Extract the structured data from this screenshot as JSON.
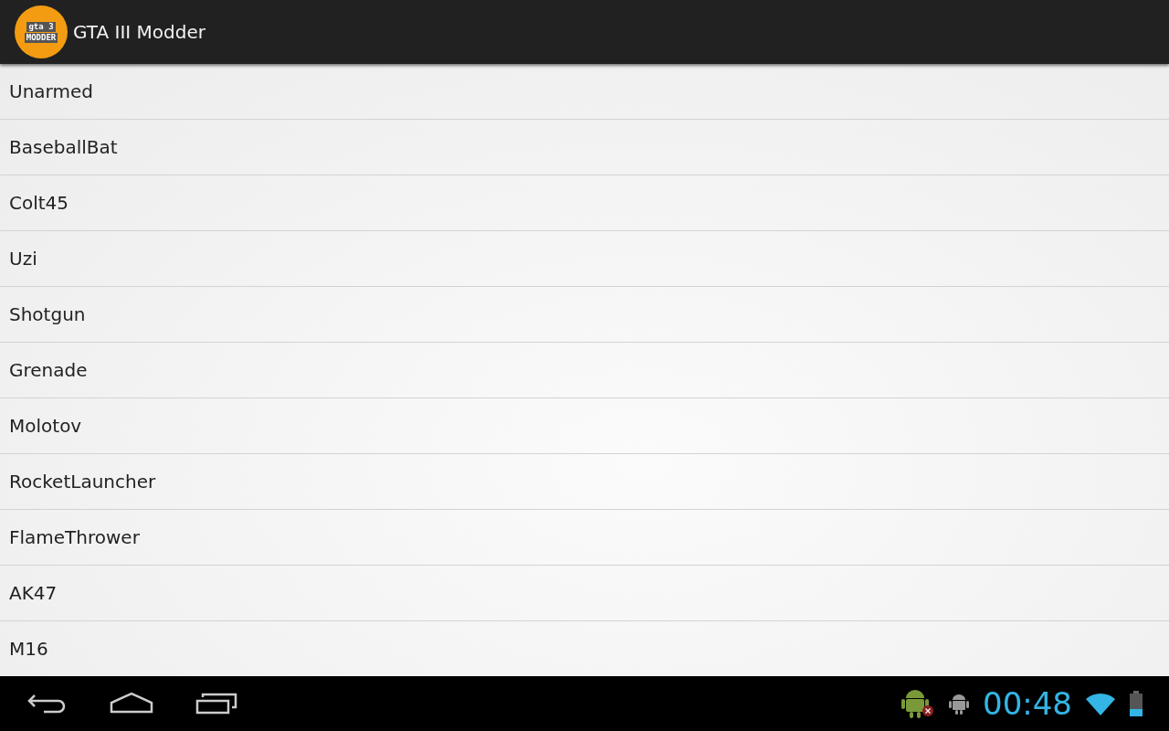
{
  "action_bar": {
    "logo_lines": [
      "gta 3",
      "MODDER"
    ],
    "title": "GTA III Modder"
  },
  "weapons": [
    "Unarmed",
    "BaseballBat",
    "Colt45",
    "Uzi",
    "Shotgun",
    "Grenade",
    "Molotov",
    "RocketLauncher",
    "FlameThrower",
    "AK47",
    "M16"
  ],
  "status_bar": {
    "time": "00:48"
  }
}
